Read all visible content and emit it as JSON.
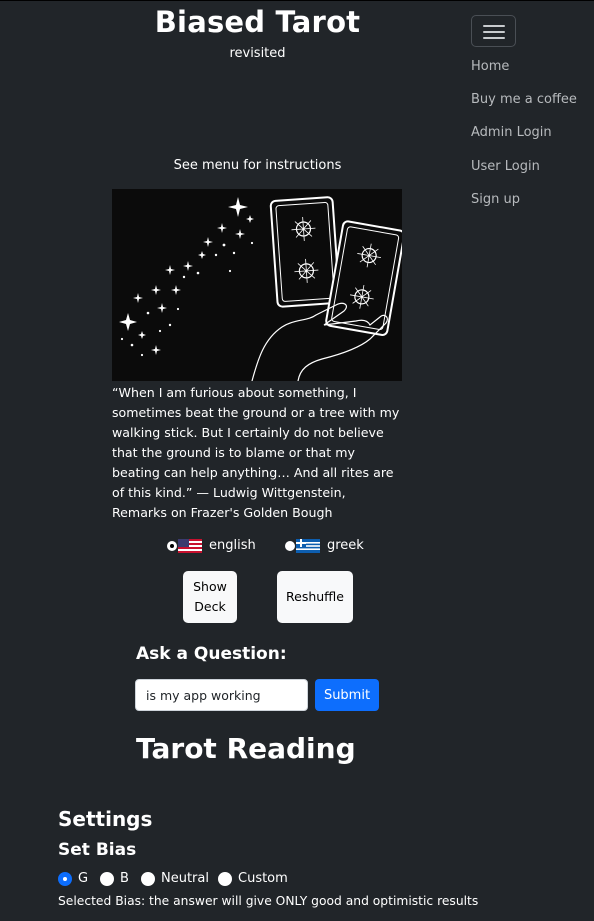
{
  "header": {
    "title": "Biased Tarot",
    "subtitle": "revisited",
    "hint": "See menu for instructions"
  },
  "nav": {
    "menu_icon": "hamburger-icon",
    "items": [
      {
        "label": "Home"
      },
      {
        "label": "Buy me a coffee"
      },
      {
        "label": "Admin Login"
      },
      {
        "label": "User Login"
      },
      {
        "label": "Sign up"
      }
    ]
  },
  "hero": {
    "image": "tarot-cards-hand-illustration"
  },
  "quote": {
    "text": "“When I am furious about something, I sometimes beat the ground or a tree with my walking stick. But I certainly do not believe that the ground is to blame or that my beating can help anything… And all rites are of this kind.” — Ludwig Wittgenstein, Remarks on Frazer's Golden Bough"
  },
  "language": {
    "options": [
      {
        "label": "english",
        "flag": "us-flag-icon",
        "selected": true
      },
      {
        "label": "greek",
        "flag": "greek-flag-icon",
        "selected": false
      }
    ]
  },
  "actions": {
    "show_deck": "Show Deck",
    "reshuffle": "Reshuffle"
  },
  "question": {
    "label": "Ask a Question:",
    "value": "is my app working",
    "submit": "Submit"
  },
  "reading": {
    "title": "Tarot Reading"
  },
  "settings": {
    "title": "Settings",
    "bias_title": "Set Bias",
    "bias_options": [
      {
        "label": "G",
        "selected": true
      },
      {
        "label": "B",
        "selected": false
      },
      {
        "label": "Neutral",
        "selected": false
      },
      {
        "label": "Custom",
        "selected": false
      }
    ],
    "selected_description": "Selected Bias: the answer will give ONLY good and optimistic results"
  },
  "colors": {
    "background": "#212529",
    "primary": "#0d6efd",
    "nav_link": "#b7babd"
  }
}
